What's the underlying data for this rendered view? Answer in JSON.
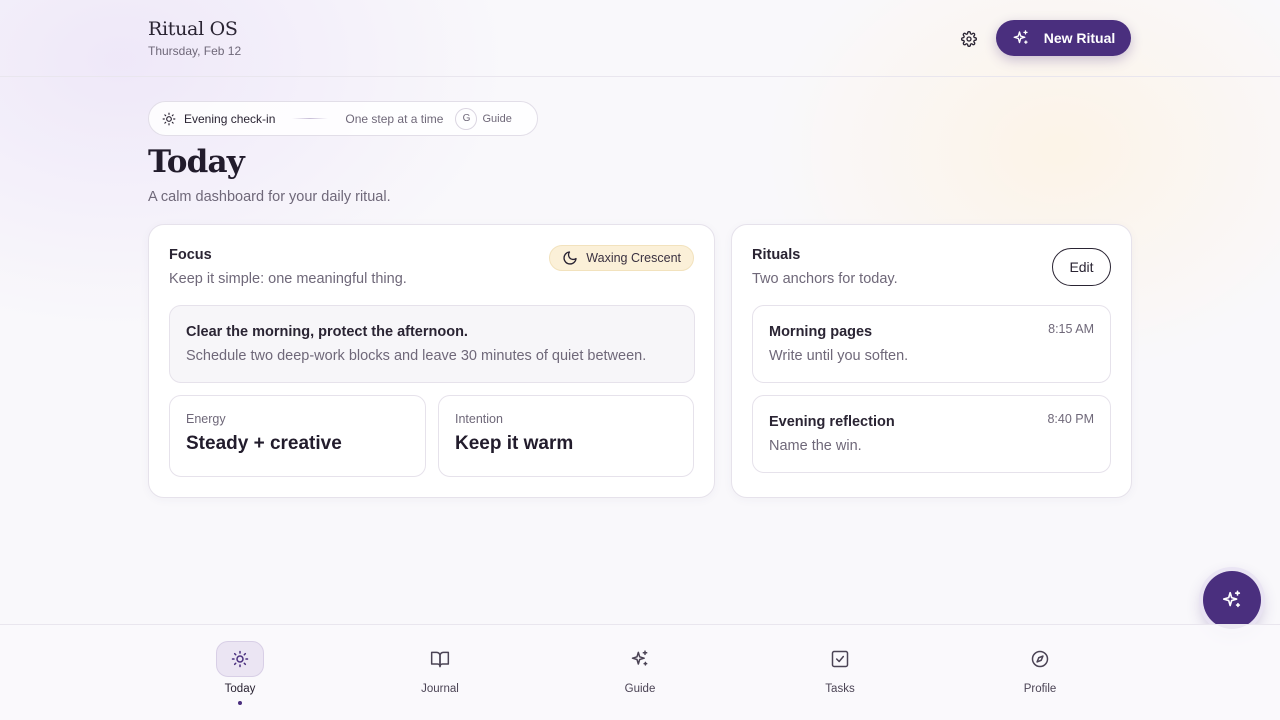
{
  "header": {
    "app_title": "Ritual OS",
    "date": "Thursday, Feb 12",
    "new_ritual_label": "New Ritual"
  },
  "checkin": {
    "label": "Evening check-in",
    "subtitle": "One step at a time",
    "shortcut_key": "G",
    "shortcut_label": "Guide"
  },
  "page": {
    "title": "Today",
    "subtitle": "A calm dashboard for your daily ritual."
  },
  "focus": {
    "title": "Focus",
    "subtitle": "Keep it simple: one meaningful thing.",
    "moon_phase": "Waxing Crescent",
    "main_text": "Clear the morning, protect the afternoon.",
    "detail_text": "Schedule two deep-work blocks and leave 30 minutes of quiet between.",
    "energy": {
      "label": "Energy",
      "value": "Steady + creative"
    },
    "intention": {
      "label": "Intention",
      "value": "Keep it warm"
    }
  },
  "rituals": {
    "title": "Rituals",
    "subtitle": "Two anchors for today.",
    "edit_label": "Edit",
    "items": [
      {
        "name": "Morning pages",
        "note": "Write until you soften.",
        "time": "8:15 AM"
      },
      {
        "name": "Evening reflection",
        "note": "Name the win.",
        "time": "8:40 PM"
      }
    ]
  },
  "nav": {
    "items": [
      {
        "label": "Today",
        "icon": "sun-icon",
        "active": true
      },
      {
        "label": "Journal",
        "icon": "book-icon"
      },
      {
        "label": "Guide",
        "icon": "sparkles-icon"
      },
      {
        "label": "Tasks",
        "icon": "checkbox-icon"
      },
      {
        "label": "Profile",
        "icon": "compass-icon"
      }
    ]
  },
  "colors": {
    "accent": "#4a2f7e",
    "moon_badge_bg": "#fbf0d8",
    "text_primary": "#2a2433",
    "text_muted": "#6f6879"
  }
}
